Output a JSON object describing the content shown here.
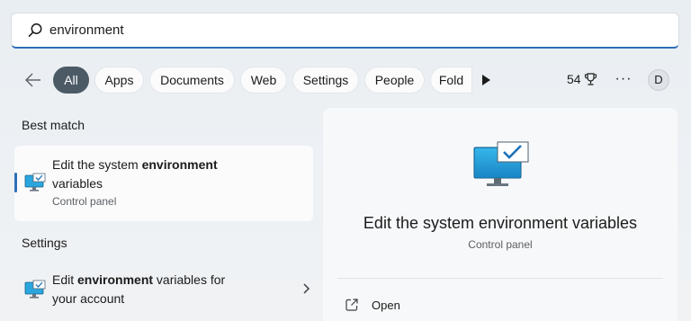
{
  "search": {
    "query": "environment"
  },
  "filters": {
    "chips": [
      "All",
      "Apps",
      "Documents",
      "Web",
      "Settings",
      "People",
      "Fold"
    ],
    "points": "54",
    "more": "···",
    "avatar_initial": "D"
  },
  "best_match": {
    "heading": "Best match",
    "title_pre": "Edit the system ",
    "title_bold": "environment",
    "title_post": "variables",
    "subtitle": "Control panel"
  },
  "settings_section": {
    "heading": "Settings",
    "title_pre": "Edit ",
    "title_bold": "environment",
    "title_mid": " variables for",
    "title_post": "your account"
  },
  "preview": {
    "title": "Edit the system environment variables",
    "subtitle": "Control panel",
    "actions": [
      {
        "label": "Open",
        "icon": "open-external-icon"
      }
    ]
  },
  "colors": {
    "accent": "#2d6fb7",
    "active_chip": "#4c5a66"
  }
}
